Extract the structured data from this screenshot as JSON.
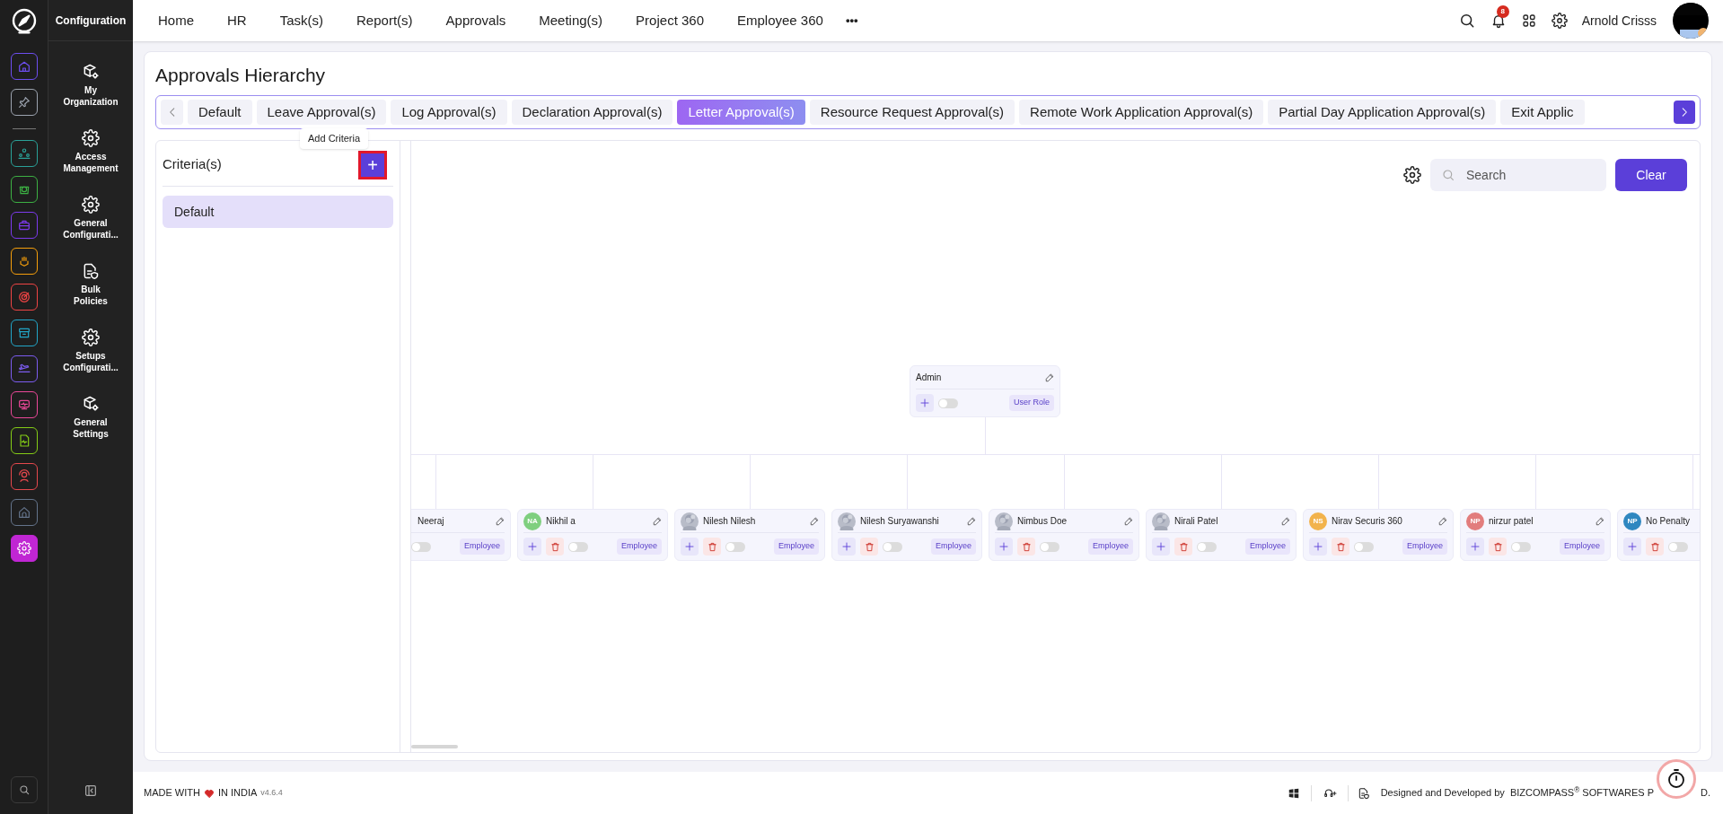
{
  "rail": {
    "items": [
      {
        "color": "#6d4ef0",
        "selected": false
      },
      {
        "color": "#9ca3af",
        "selected": false
      },
      {
        "color": "#2aa198",
        "selected": false
      },
      {
        "color": "#3cb043",
        "selected": false
      },
      {
        "color": "#7c3aed",
        "selected": false
      },
      {
        "color": "#f59e0b",
        "selected": false
      },
      {
        "color": "#ef4444",
        "selected": false
      },
      {
        "color": "#22a6c8",
        "selected": false
      },
      {
        "color": "#7c5cf0",
        "selected": false
      },
      {
        "color": "#ec4899",
        "selected": false
      },
      {
        "color": "#84cc16",
        "selected": false
      },
      {
        "color": "#e5484d",
        "selected": false
      },
      {
        "color": "#64748b",
        "selected": false
      },
      {
        "color": "#c026d3",
        "selected": true
      }
    ]
  },
  "module": {
    "title": "Configuration",
    "items": [
      {
        "kind": "cube-gear",
        "label": "My Organization"
      },
      {
        "kind": "gear",
        "label": "Access Management"
      },
      {
        "kind": "gear",
        "label": "General Configurati..."
      },
      {
        "kind": "document",
        "label": "Bulk Policies"
      },
      {
        "kind": "gear",
        "label": "Setups Configurati..."
      },
      {
        "kind": "cube-gear",
        "label": "General Settings"
      }
    ]
  },
  "nav": {
    "items": [
      "Home",
      "HR",
      "Task(s)",
      "Report(s)",
      "Approvals",
      "Meeting(s)",
      "Project 360",
      "Employee 360"
    ],
    "more": "•••",
    "notifications": "8",
    "user": "Arnold Crisss"
  },
  "page": {
    "title": "Approvals Hierarchy",
    "tabs": [
      {
        "label": "Default",
        "selected": false
      },
      {
        "label": "Leave Approval(s)",
        "selected": false
      },
      {
        "label": "Log Approval(s)",
        "selected": false
      },
      {
        "label": "Declaration Approval(s)",
        "selected": false
      },
      {
        "label": "Letter Approval(s)",
        "selected": true
      },
      {
        "label": "Resource Request Approval(s)",
        "selected": false
      },
      {
        "label": "Remote Work Application Approval(s)",
        "selected": false
      },
      {
        "label": "Partial Day Application Approval(s)",
        "selected": false
      },
      {
        "label": "Exit Applic",
        "selected": false
      }
    ]
  },
  "criteria": {
    "title": "Criteria(s)",
    "tooltip": "Add Criteria",
    "add": "+",
    "items": [
      {
        "label": "Default",
        "selected": true
      }
    ]
  },
  "hierarchy": {
    "search_placeholder": "Search",
    "clear": "Clear",
    "root": {
      "name": "Admin",
      "role": "User Role",
      "on": false
    },
    "children": [
      {
        "name": "Neeraj",
        "kind": "none",
        "role": "Employee",
        "on": false
      },
      {
        "name": "Nikhil a",
        "kind": "initials",
        "initials": "NA",
        "color": "#7fcf7f",
        "role": "Employee",
        "on": false
      },
      {
        "name": "Nilesh Nilesh",
        "role": "Employee",
        "on": false
      },
      {
        "name": "Nilesh Suryawanshi",
        "role": "Employee",
        "on": false
      },
      {
        "name": "Nimbus Doe",
        "role": "Employee",
        "on": false
      },
      {
        "name": "Nirali Patel",
        "role": "Employee",
        "on": false
      },
      {
        "name": "Nirav Securis 360",
        "kind": "initials",
        "initials": "NS",
        "color": "#f2b34c",
        "role": "Employee",
        "on": false
      },
      {
        "name": "nirzur patel",
        "kind": "initials",
        "initials": "NP",
        "color": "#e27d7d",
        "role": "Employee",
        "on": false
      },
      {
        "name": "No Penalty",
        "kind": "initials",
        "initials": "NP",
        "color": "#2f87c0",
        "on": false
      }
    ]
  },
  "footer": {
    "made_with": "MADE WITH",
    "in_india": "IN INDIA",
    "version": "v4.6.4",
    "designed": "Designed and Developed by",
    "company": "BIZCOMPASS$^{®}$ SOFTWARES P",
    "company_end": "D."
  }
}
